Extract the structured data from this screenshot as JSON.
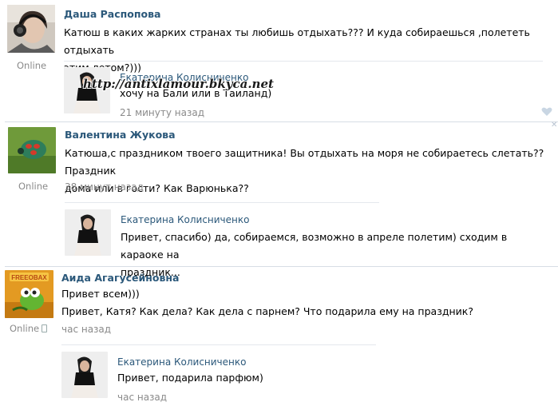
{
  "comment1": {
    "author": "Даша Распопова",
    "status": "Online",
    "text_line1": "Катюш в каких жарких странах ты любишь отдыхать??? И куда собираешься ,полететь отдыхать",
    "text_line2": "этим летом?)))"
  },
  "reply1": {
    "author": "Екатерина Колисниченко",
    "text": "хочу на Бали или в Таиланд)",
    "time": "21 минуту назад",
    "watermark": "http://antixlamour.bkyca.net"
  },
  "comment2": {
    "author": "Валентина Жукова",
    "status": "Online",
    "text_line1": "Катюша,с праздником твоего защитника! Вы отдыхать на моря не собираетесь слетать?? Праздник",
    "text_line2": "дома или в гости? Как Варюнька??",
    "time": "38 минут назад"
  },
  "reply2": {
    "author": "Екатерина Колисниченко",
    "text_line1": "Привет, спасибо) да, собираемся, возможно в апреле полетим) сходим в караоке на",
    "text_line2": "праздник..."
  },
  "comment3": {
    "author": "Аида Агагусейновна",
    "status": "Online",
    "text_line1": "Привет всем)))",
    "text_line2": "Привет, Катя? Как дела? Как дела с парнем? Что подарила ему на праздник?",
    "time": "час назад",
    "avatar_label": "FREEOBAX"
  },
  "reply3": {
    "author": "Екатерина Колисниченко",
    "text": "Привет, подарила парфюм)",
    "time": "час назад"
  },
  "colors": {
    "link": "#2b587a",
    "muted": "#8a8a8a",
    "separator": "#d7dde5"
  }
}
